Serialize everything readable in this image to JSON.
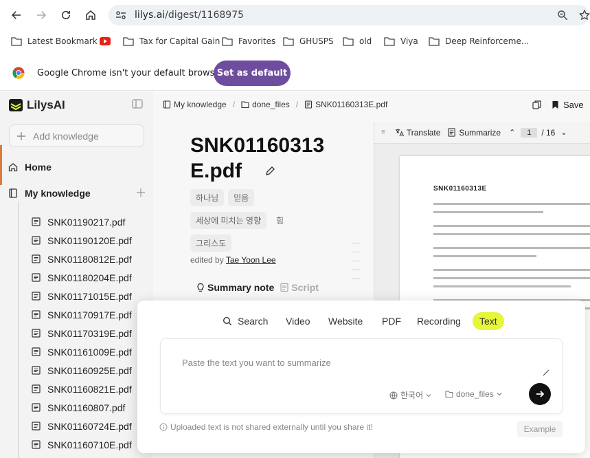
{
  "browser": {
    "url_host": "lilys.ai",
    "url_path": "/digest/1168975",
    "bookmarks": [
      "Latest Bookmark",
      "Tax for Capital Gain",
      "Favorites",
      "GHUSPS",
      "old",
      "Viya",
      "Deep Reinforceme..."
    ],
    "infobar_message": "Google Chrome isn't your default browser",
    "infobar_button": "Set as default"
  },
  "sidebar": {
    "brand": "LilysAI",
    "add_knowledge": "Add knowledge",
    "home": "Home",
    "my_knowledge": "My knowledge",
    "files": [
      "SNK01190217.pdf",
      "SNK01190120E.pdf",
      "SNK01180812E.pdf",
      "SNK01180204E.pdf",
      "SNK01171015E.pdf",
      "SNK01170917E.pdf",
      "SNK01170319E.pdf",
      "SNK01161009E.pdf",
      "SNK01160925E.pdf",
      "SNK01160821E.pdf",
      "SNK01160807.pdf",
      "SNK01160724E.pdf",
      "SNK01160710E.pdf"
    ]
  },
  "main": {
    "breadcrumb": [
      "My knowledge",
      "done_files",
      "SNK01160313E.pdf"
    ],
    "save_label": "Save",
    "doc_title": "SNK01160313E.pdf",
    "tags": [
      "하나님",
      "믿음",
      "세상에 미치는 영향",
      "힘",
      "그리스도"
    ],
    "edited_prefix": "edited by",
    "editor": "Tae Yoon Lee",
    "tab_summary": "Summary note",
    "tab_script": "Script"
  },
  "pdf": {
    "translate": "Translate",
    "summarize": "Summarize",
    "page_current": "1",
    "page_total": "/ 16",
    "page_title": "SNK01160313E"
  },
  "overlay": {
    "tabs": [
      "Search",
      "Video",
      "Website",
      "PDF",
      "Recording",
      "Text"
    ],
    "active_tab": "Text",
    "placeholder": "Paste the text you want to summarize",
    "language": "한국어",
    "folder": "done_files",
    "note": "Uploaded text is not shared externally until you share it!",
    "example": "Example"
  },
  "colors": {
    "accent_purple": "#6e4d9e",
    "active_tab_highlight": "#e6f63a",
    "sidebar_accent": "#e07a3a"
  }
}
